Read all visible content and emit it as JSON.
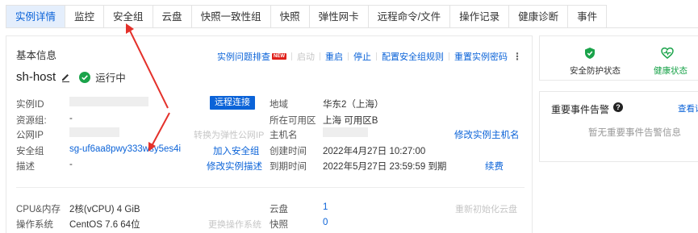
{
  "tabs": [
    "实例详情",
    "监控",
    "安全组",
    "云盘",
    "快照一致性组",
    "快照",
    "弹性网卡",
    "远程命令/文件",
    "操作记录",
    "健康诊断",
    "事件"
  ],
  "basic": {
    "title": "基本信息",
    "actions": {
      "troubleshoot": "实例问题排查",
      "new_badge": "NEW",
      "start": "启动",
      "restart": "重启",
      "stop": "停止",
      "config_sg": "配置安全组规则",
      "reset_pwd": "重置实例密码",
      "more": "⋮"
    },
    "host_name": "sh-host",
    "status": "运行中",
    "labels": {
      "instance_id": "实例ID",
      "resource_group": "资源组:",
      "public_ip": "公网IP",
      "security_group": "安全组",
      "description": "描述"
    },
    "values": {
      "resource_group": "-",
      "security_group": "sg-uf6aa8pwy333wsy5es4i",
      "description": "-"
    },
    "mid_actions": {
      "remote_connect": "远程连接",
      "convert_eip": "转换为弹性公网IP",
      "join_sg": "加入安全组",
      "modify_desc": "修改实例描述"
    },
    "right_labels": {
      "region": "地域",
      "zone": "所在可用区",
      "hostname": "主机名",
      "created": "创建时间",
      "expire": "到期时间"
    },
    "right_values": {
      "region": "华东2（上海）",
      "zone": "上海 可用区B",
      "created": "2022年4月27日 10:27:00",
      "expire": "2022年5月27日 23:59:59 到期"
    },
    "right_links": {
      "modify_hostname": "修改实例主机名",
      "renew": "续费"
    },
    "spec": {
      "cpu_label": "CPU&内存",
      "cpu_value": "2核(vCPU) 4 GiB",
      "os_label": "操作系统",
      "os_value": "CentOS 7.6 64位",
      "change_os": "更换操作系统",
      "disk_label": "云盘",
      "disk_value": "1",
      "reinit_disk": "重新初始化云盘",
      "snapshot_label": "快照",
      "snapshot_value": "0"
    }
  },
  "side": {
    "security_status": "安全防护状态",
    "health_status": "健康状态",
    "alarm_title": "重要事件告警",
    "alarm_link": "查看详",
    "alarm_empty": "暂无重要事件告警信息"
  },
  "colors": {
    "accent": "#0b63d8",
    "running": "#1aa34a",
    "arrow": "#e4312b"
  }
}
